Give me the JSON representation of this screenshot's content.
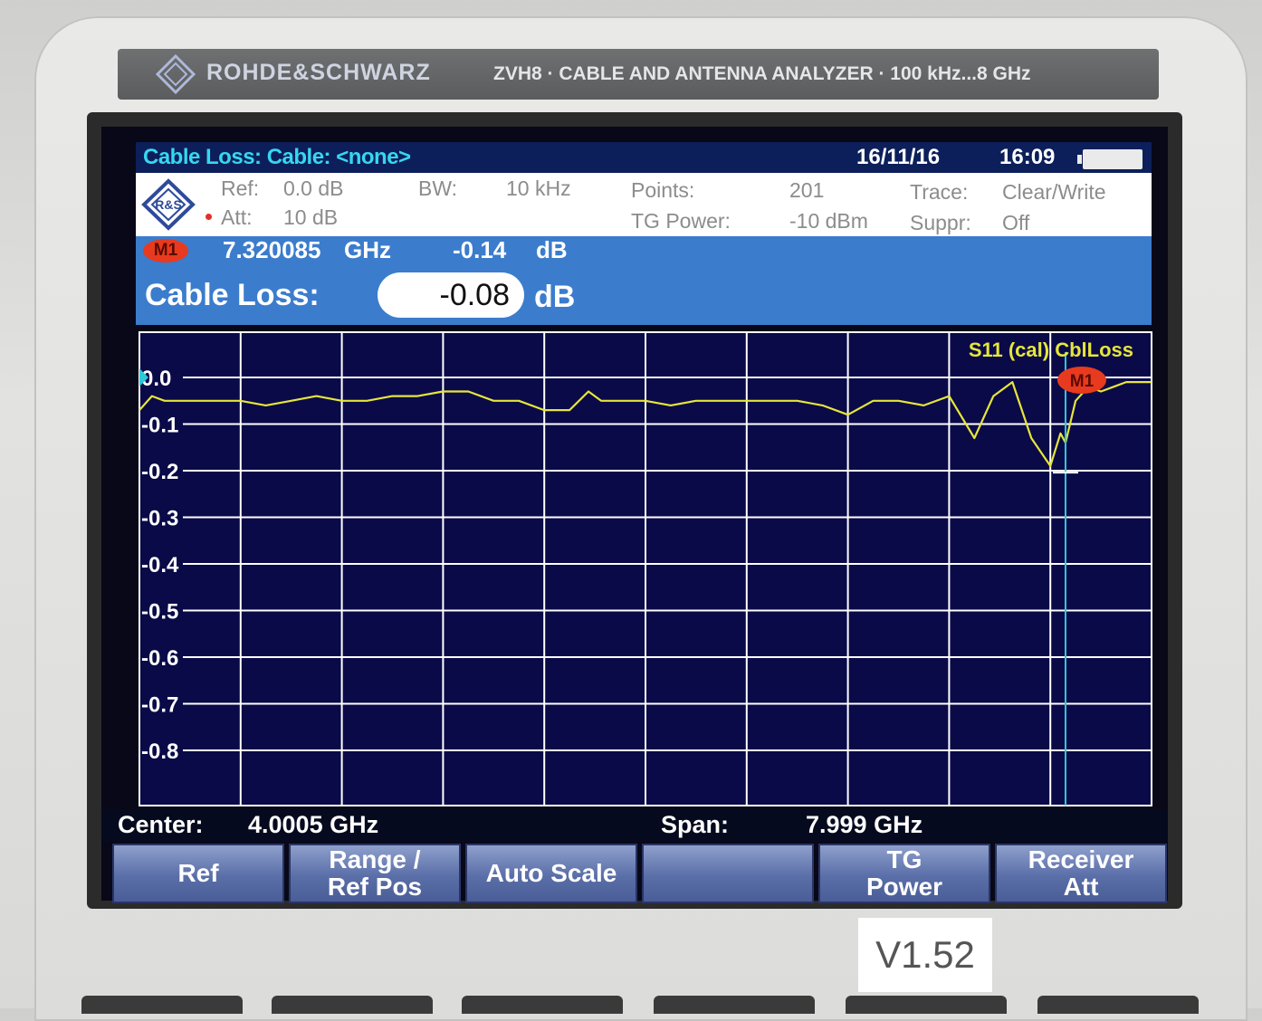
{
  "device": {
    "brand": "ROHDE&SCHWARZ",
    "model": "ZVH8 · CABLE AND ANTENNA ANALYZER · 100 kHz...8 GHz",
    "version_label": "V1.52"
  },
  "title_bar": {
    "mode": "Cable Loss:  Cable: <none>",
    "date": "16/11/16",
    "time": "16:09"
  },
  "settings": {
    "ref_label": "Ref:",
    "ref_value": "0.0 dB",
    "att_label": "Att:",
    "att_value": "10 dB",
    "bw_label": "BW:",
    "bw_value": "10 kHz",
    "points_label": "Points:",
    "points_value": "201",
    "tg_power_label": "TG Power:",
    "tg_power_value": "-10 dBm",
    "trace_label": "Trace:",
    "trace_value": "Clear/Write",
    "suppr_label": "Suppr:",
    "suppr_value": "Off"
  },
  "marker": {
    "name": "M1",
    "frequency": "7.320085",
    "frequency_unit": "GHz",
    "level": "-0.14",
    "level_unit": "dB"
  },
  "cable_loss": {
    "label": "Cable Loss:",
    "value": "-0.08",
    "unit": "dB"
  },
  "plot": {
    "trace_label": "S11 (cal) CblLoss",
    "marker_label": "M1",
    "colors": {
      "background": "#0a0a48",
      "grid": "#ffffff",
      "trace": "#e6e63a",
      "marker_line": "#2fc8d8",
      "marker": "#e83a1e"
    }
  },
  "chart_data": {
    "type": "line",
    "ylim": [
      -0.9,
      0.0
    ],
    "xlim": [
      0.001,
      8.0
    ],
    "yticks": [
      "0.0",
      "-0.1",
      "-0.2",
      "-0.3",
      "-0.4",
      "-0.5",
      "-0.6",
      "-0.7",
      "-0.8"
    ],
    "ytick_values": [
      0.0,
      -0.1,
      -0.2,
      -0.3,
      -0.4,
      -0.5,
      -0.6,
      -0.7,
      -0.8
    ],
    "x_divisions": 10,
    "series": [
      {
        "name": "S11 (cal) CblLoss",
        "x": [
          0.001,
          0.1,
          0.2,
          0.4,
          0.6,
          0.8,
          1.0,
          1.2,
          1.4,
          1.6,
          1.8,
          2.0,
          2.2,
          2.4,
          2.6,
          2.8,
          3.0,
          3.2,
          3.4,
          3.55,
          3.65,
          3.8,
          4.0,
          4.2,
          4.4,
          4.6,
          4.8,
          5.0,
          5.2,
          5.4,
          5.6,
          5.8,
          6.0,
          6.2,
          6.4,
          6.6,
          6.75,
          6.9,
          7.05,
          7.2,
          7.28,
          7.32,
          7.4,
          7.5,
          7.6,
          7.7,
          7.8,
          7.9,
          8.0
        ],
        "y": [
          -0.07,
          -0.04,
          -0.05,
          -0.05,
          -0.05,
          -0.05,
          -0.06,
          -0.05,
          -0.04,
          -0.05,
          -0.05,
          -0.04,
          -0.04,
          -0.03,
          -0.03,
          -0.05,
          -0.05,
          -0.07,
          -0.07,
          -0.03,
          -0.05,
          -0.05,
          -0.05,
          -0.06,
          -0.05,
          -0.05,
          -0.05,
          -0.05,
          -0.05,
          -0.06,
          -0.08,
          -0.05,
          -0.05,
          -0.06,
          -0.04,
          -0.13,
          -0.04,
          -0.01,
          -0.13,
          -0.19,
          -0.12,
          -0.14,
          -0.05,
          -0.02,
          -0.03,
          -0.02,
          -0.01,
          -0.01,
          -0.01
        ]
      }
    ],
    "marker": {
      "name": "M1",
      "x": 7.320085,
      "y": -0.14
    }
  },
  "footer": {
    "center_label": "Center:",
    "center_value": "4.0005 GHz",
    "span_label": "Span:",
    "span_value": "7.999 GHz"
  },
  "softkeys": [
    {
      "line1": "Ref",
      "line2": ""
    },
    {
      "line1": "Range /",
      "line2": "Ref Pos"
    },
    {
      "line1": "Auto Scale",
      "line2": ""
    },
    {
      "line1": "",
      "line2": ""
    },
    {
      "line1": "TG",
      "line2": "Power"
    },
    {
      "line1": "Receiver",
      "line2": "Att"
    }
  ]
}
